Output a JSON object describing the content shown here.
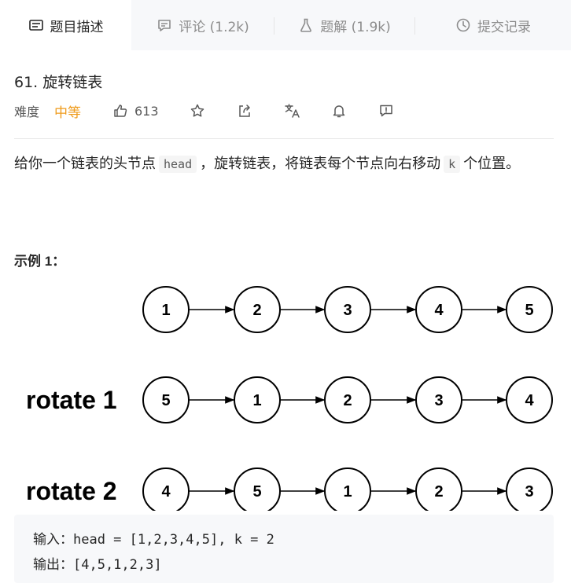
{
  "tabs": [
    {
      "label": "题目描述",
      "icon": "description-icon"
    },
    {
      "label": "评论 (1.2k)",
      "icon": "comment-icon"
    },
    {
      "label": "题解 (1.9k)",
      "icon": "flask-icon"
    },
    {
      "label": "提交记录",
      "icon": "clock-icon"
    }
  ],
  "problem": {
    "title": "61. 旋转链表",
    "difficulty_label": "难度",
    "difficulty_value": "中等",
    "likes": "613"
  },
  "description": {
    "part1": "给你一个链表的头节点",
    "code1": "head",
    "part2": "，旋转链表，将链表每个节点向右移动",
    "code2": "k",
    "part3": "个位置。"
  },
  "example": {
    "title": "示例 1：",
    "row_labels": [
      "",
      "rotate 1",
      "rotate 2"
    ],
    "rows": [
      [
        "1",
        "2",
        "3",
        "4",
        "5"
      ],
      [
        "5",
        "1",
        "2",
        "3",
        "4"
      ],
      [
        "4",
        "5",
        "1",
        "2",
        "3"
      ]
    ],
    "input_line": "输入：head = [1,2,3,4,5], k = 2",
    "output_line": "输出：[4,5,1,2,3]"
  },
  "colors": {
    "difficulty": "#ef9b1b",
    "tab_bg": "#f7f8fa"
  }
}
